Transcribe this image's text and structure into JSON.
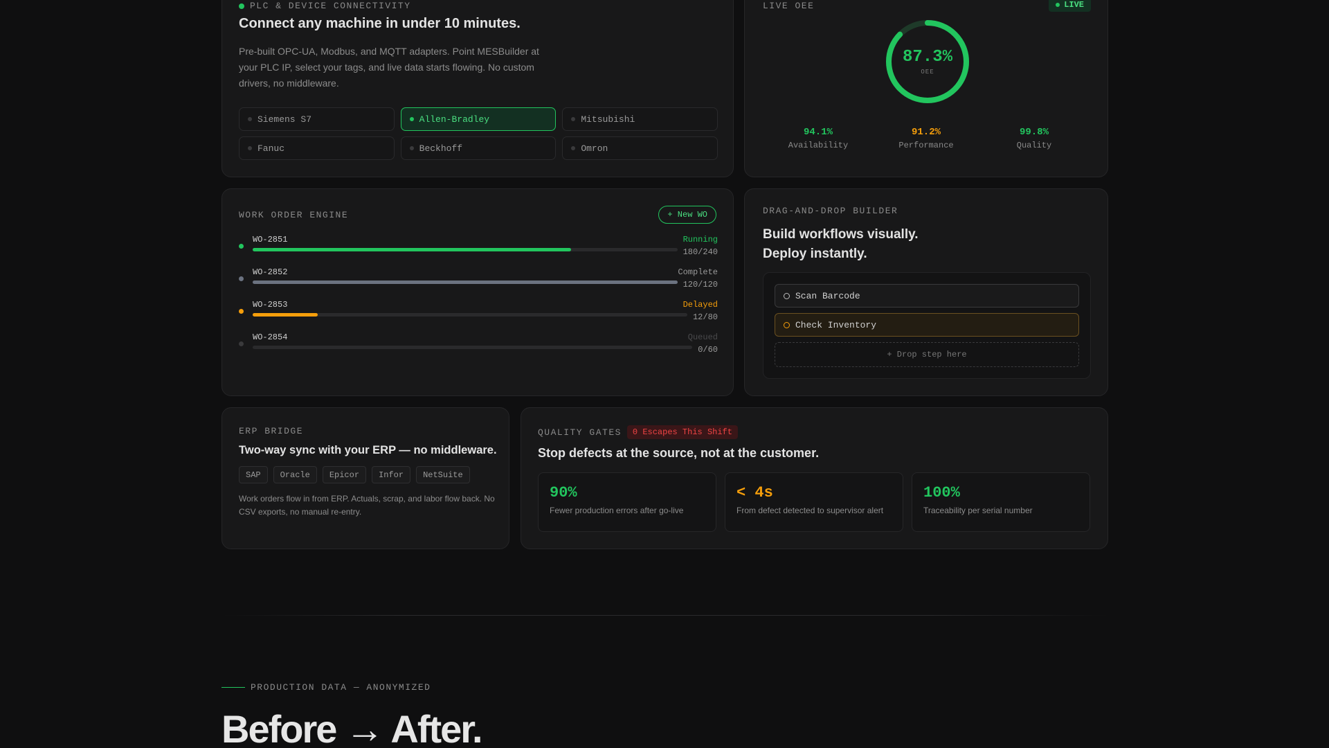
{
  "plc": {
    "eyebrow": "PLC & DEVICE CONNECTIVITY",
    "title": "Connect any machine in under 10 minutes.",
    "description": "Pre-built OPC-UA, Modbus, and MQTT adapters. Point MESBuilder at your PLC IP, select your tags, and live data starts flowing. No custom drivers, no middleware.",
    "devices": [
      "Siemens S7",
      "Allen-Bradley",
      "Mitsubishi",
      "Fanuc",
      "Beckhoff",
      "Omron"
    ],
    "active_device": "Allen-Bradley"
  },
  "oee": {
    "eyebrow": "LIVE OEE",
    "badge": "LIVE",
    "value": "87.3%",
    "value_fraction": 0.873,
    "label": "OEE",
    "metrics": [
      {
        "value": "94.1%",
        "label": "Availability",
        "color": "#22c55e"
      },
      {
        "value": "91.2%",
        "label": "Performance",
        "color": "#f59e0b"
      },
      {
        "value": "99.8%",
        "label": "Quality",
        "color": "#22c55e"
      }
    ]
  },
  "work_orders": {
    "eyebrow": "WORK ORDER ENGINE",
    "new_button": "+ New WO",
    "rows": [
      {
        "id": "WO-2851",
        "status": "Running",
        "count": "180/240",
        "progress": 0.75,
        "color": "#22c55e",
        "status_color": "#22c55e"
      },
      {
        "id": "WO-2852",
        "status": "Complete",
        "count": "120/120",
        "progress": 1.0,
        "color": "#6b7280",
        "status_color": "#9a9a9a"
      },
      {
        "id": "WO-2853",
        "status": "Delayed",
        "count": "12/80",
        "progress": 0.15,
        "color": "#f59e0b",
        "status_color": "#f59e0b"
      },
      {
        "id": "WO-2854",
        "status": "Queued",
        "count": "0/60",
        "progress": 0,
        "color": "#3a3a3c",
        "status_color": "#4a4a4c"
      }
    ]
  },
  "dnd": {
    "eyebrow": "DRAG-AND-DROP BUILDER",
    "title_line1": "Build workflows visually.",
    "title_line2": "Deploy instantly.",
    "steps": [
      "Scan Barcode",
      "Check Inventory"
    ],
    "drop_label": "+ Drop step here"
  },
  "erp": {
    "eyebrow": "ERP BRIDGE",
    "title": "Two-way sync with your ERP — no middleware.",
    "tags": [
      "SAP",
      "Oracle",
      "Epicor",
      "Infor",
      "NetSuite"
    ],
    "description": "Work orders flow in from ERP. Actuals, scrap, and labor flow back. No CSV exports, no manual re-entry."
  },
  "quality": {
    "eyebrow": "QUALITY GATES",
    "badge": "0 Escapes This Shift",
    "title": "Stop defects at the source, not at the customer.",
    "stats": [
      {
        "value": "90%",
        "label": "Fewer production errors after go-live",
        "color": "#22c55e"
      },
      {
        "value": "< 4s",
        "label": "From defect detected to supervisor alert",
        "color": "#f59e0b"
      },
      {
        "value": "100%",
        "label": "Traceability per serial number",
        "color": "#22c55e"
      }
    ]
  },
  "section": {
    "eyebrow": "PRODUCTION DATA — ANONYMIZED",
    "title": "Before → After."
  },
  "colors": {
    "accent_green": "#22c55e",
    "accent_amber": "#f59e0b",
    "accent_red": "#ef4444",
    "background": "#0f0f10"
  }
}
